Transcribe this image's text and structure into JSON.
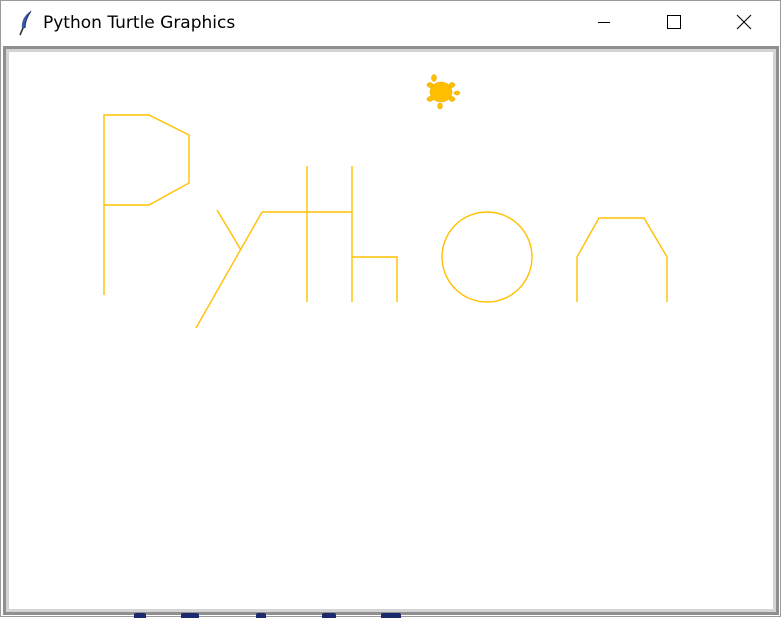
{
  "window": {
    "title": "Python Turtle Graphics",
    "controls": [
      "minimize",
      "maximize",
      "close"
    ]
  },
  "icons": {
    "app": "feather-icon",
    "minimize": "minimize-icon",
    "maximize": "maximize-icon",
    "close": "close-icon",
    "turtle": "turtle-icon"
  },
  "canvas": {
    "background": "#ffffff",
    "pen_color": "#ffc000",
    "turtle_color": "#ffbf00"
  }
}
